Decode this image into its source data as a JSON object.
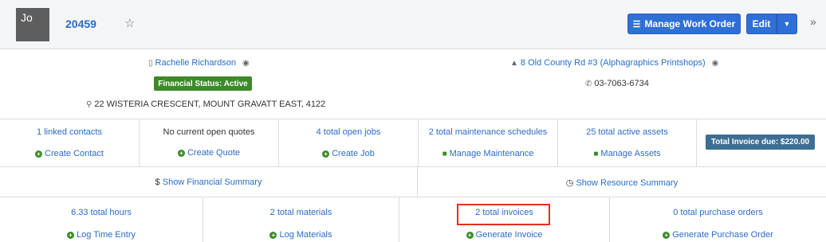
{
  "header": {
    "avatar_initials": "Jo",
    "work_order_number": "20459",
    "manage_label": "Manage Work Order",
    "edit_label": "Edit"
  },
  "client": {
    "name": "Rachelle Richardson",
    "financial_status": "Financial Status: Active",
    "address": "22 WISTERIA CRESCENT, MOUNT GRAVATT EAST, 4122"
  },
  "site": {
    "name": "8 Old County Rd #3 (Alphagraphics Printshops)",
    "phone": "03-7063-6734"
  },
  "stats": [
    {
      "top": "1 linked contacts",
      "action": "Create Contact"
    },
    {
      "top": "No current open quotes",
      "action": "Create Quote"
    },
    {
      "top": "4 total open jobs",
      "action": "Create Job"
    },
    {
      "top": "2 total maintenance schedules",
      "action": "Manage Maintenance"
    },
    {
      "top": "25 total active assets",
      "action": "Manage Assets"
    }
  ],
  "total_invoice_due": "Total Invoice due: $220.00",
  "summary": {
    "financial": "Show Financial Summary",
    "resource": "Show Resource Summary"
  },
  "bottom": [
    {
      "top": "6.33 total hours",
      "action": "Log Time Entry"
    },
    {
      "top": "2 total materials",
      "action": "Log Materials"
    },
    {
      "top": "2 total invoices",
      "action": "Generate Invoice"
    },
    {
      "top": "0 total purchase orders",
      "action": "Generate Purchase Order"
    }
  ],
  "colors": {
    "primary": "#2f6fd6",
    "success": "#3c8a28",
    "info_badge": "#3c6f93",
    "highlight": "#e0301e",
    "link": "#2a6cc7"
  }
}
